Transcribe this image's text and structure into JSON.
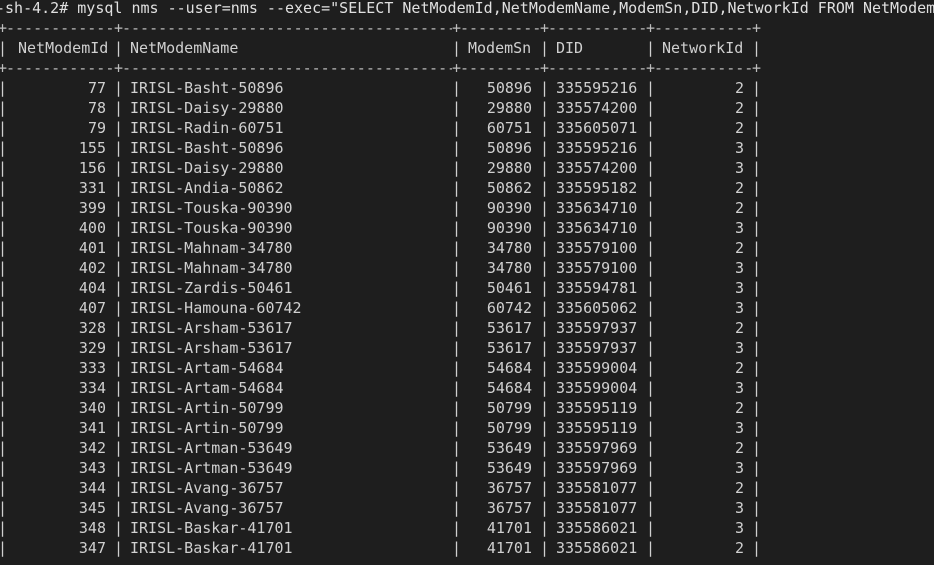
{
  "terminal": {
    "prompt": "-sh-4.2#",
    "command": "mysql nms --user=nms --exec=\"SELECT NetModemId,NetModemName,ModemSn,DID,NetworkId FROM NetModem\"",
    "separator_char": "-"
  },
  "table": {
    "headers": {
      "netmodemid": "NetModemId",
      "netmodemname": "NetModemName",
      "modemsn": "ModemSn",
      "did": "DID",
      "networkid": "NetworkId"
    },
    "rows": [
      {
        "id": "77",
        "name": "IRISL-Basht-50896",
        "sn": "50896",
        "did": "335595216",
        "net": "2"
      },
      {
        "id": "78",
        "name": "IRISL-Daisy-29880",
        "sn": "29880",
        "did": "335574200",
        "net": "2"
      },
      {
        "id": "79",
        "name": "IRISL-Radin-60751",
        "sn": "60751",
        "did": "335605071",
        "net": "2"
      },
      {
        "id": "155",
        "name": "IRISL-Basht-50896",
        "sn": "50896",
        "did": "335595216",
        "net": "3"
      },
      {
        "id": "156",
        "name": "IRISL-Daisy-29880",
        "sn": "29880",
        "did": "335574200",
        "net": "3"
      },
      {
        "id": "331",
        "name": "IRISL-Andia-50862",
        "sn": "50862",
        "did": "335595182",
        "net": "2"
      },
      {
        "id": "399",
        "name": "IRISL-Touska-90390",
        "sn": "90390",
        "did": "335634710",
        "net": "2"
      },
      {
        "id": "400",
        "name": "IRISL-Touska-90390",
        "sn": "90390",
        "did": "335634710",
        "net": "3"
      },
      {
        "id": "401",
        "name": "IRISL-Mahnam-34780",
        "sn": "34780",
        "did": "335579100",
        "net": "2"
      },
      {
        "id": "402",
        "name": "IRISL-Mahnam-34780",
        "sn": "34780",
        "did": "335579100",
        "net": "3"
      },
      {
        "id": "404",
        "name": "IRISL-Zardis-50461",
        "sn": "50461",
        "did": "335594781",
        "net": "3"
      },
      {
        "id": "407",
        "name": "IRISL-Hamouna-60742",
        "sn": "60742",
        "did": "335605062",
        "net": "3"
      },
      {
        "id": "328",
        "name": "IRISL-Arsham-53617",
        "sn": "53617",
        "did": "335597937",
        "net": "2"
      },
      {
        "id": "329",
        "name": "IRISL-Arsham-53617",
        "sn": "53617",
        "did": "335597937",
        "net": "3"
      },
      {
        "id": "333",
        "name": "IRISL-Artam-54684",
        "sn": "54684",
        "did": "335599004",
        "net": "2"
      },
      {
        "id": "334",
        "name": "IRISL-Artam-54684",
        "sn": "54684",
        "did": "335599004",
        "net": "3"
      },
      {
        "id": "340",
        "name": "IRISL-Artin-50799",
        "sn": "50799",
        "did": "335595119",
        "net": "2"
      },
      {
        "id": "341",
        "name": "IRISL-Artin-50799",
        "sn": "50799",
        "did": "335595119",
        "net": "3"
      },
      {
        "id": "342",
        "name": "IRISL-Artman-53649",
        "sn": "53649",
        "did": "335597969",
        "net": "2"
      },
      {
        "id": "343",
        "name": "IRISL-Artman-53649",
        "sn": "53649",
        "did": "335597969",
        "net": "3"
      },
      {
        "id": "344",
        "name": "IRISL-Avang-36757",
        "sn": "36757",
        "did": "335581077",
        "net": "2"
      },
      {
        "id": "345",
        "name": "IRISL-Avang-36757",
        "sn": "36757",
        "did": "335581077",
        "net": "3"
      },
      {
        "id": "348",
        "name": "IRISL-Baskar-41701",
        "sn": "41701",
        "did": "335586021",
        "net": "3"
      },
      {
        "id": "347",
        "name": "IRISL-Baskar-41701",
        "sn": "41701",
        "did": "335586021",
        "net": "2"
      }
    ]
  }
}
